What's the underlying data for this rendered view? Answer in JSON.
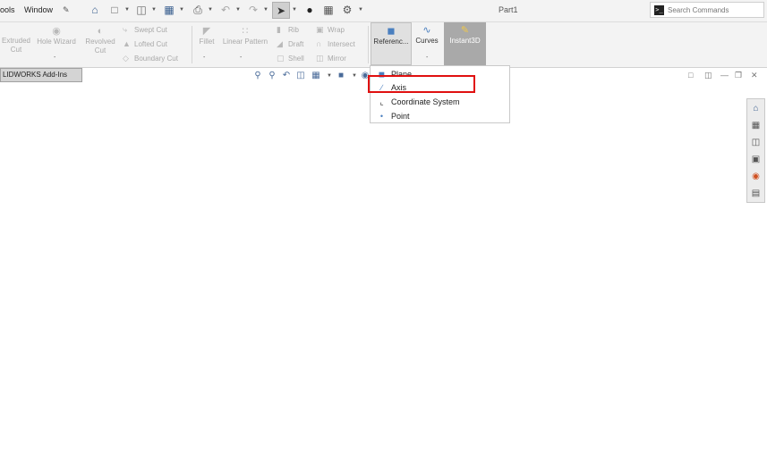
{
  "menu": {
    "tools": "ools",
    "window": "Window",
    "pin_icon": "pin-icon"
  },
  "toolbar": {
    "icons": [
      "home-icon",
      "new-document-icon",
      "open-folder-icon",
      "save-icon",
      "print-icon",
      "undo-icon",
      "redo-icon",
      "select-cursor-icon",
      "traffic-light-icon",
      "file-properties-icon",
      "options-gear-icon"
    ]
  },
  "document": {
    "title": "Part1"
  },
  "search": {
    "placeholder": "Search Commands",
    "value": ""
  },
  "ribbon": {
    "extruded_cut": [
      "Extruded",
      "Cut"
    ],
    "hole_wizard": "Hole Wizard",
    "revolved_cut": [
      "Revolved",
      "Cut"
    ],
    "swept_cut": "Swept Cut",
    "lofted_cut": "Lofted Cut",
    "boundary_cut": "Boundary Cut",
    "fillet": "Fillet",
    "linear_pattern": "Linear Pattern",
    "rib": "Rib",
    "draft": "Draft",
    "shell": "Shell",
    "wrap": "Wrap",
    "intersect": "Intersect",
    "mirror": "Mirror",
    "reference_geometry": "Referenc...",
    "curves": "Curves",
    "instant3d": "Instant3D"
  },
  "tabs": {
    "addins": "LIDWORKS Add-Ins"
  },
  "dropdown": {
    "items": [
      {
        "label": "Plane",
        "icon": "plane-icon"
      },
      {
        "label": "Axis",
        "icon": "axis-icon"
      },
      {
        "label": "Coordinate System",
        "icon": "coordinate-system-icon"
      },
      {
        "label": "Point",
        "icon": "point-icon"
      }
    ],
    "highlighted": "Axis"
  },
  "colors": {
    "highlight": "#e01010",
    "accent": "#4a7fbf",
    "instant3d_bg": "#a9a9a9"
  }
}
